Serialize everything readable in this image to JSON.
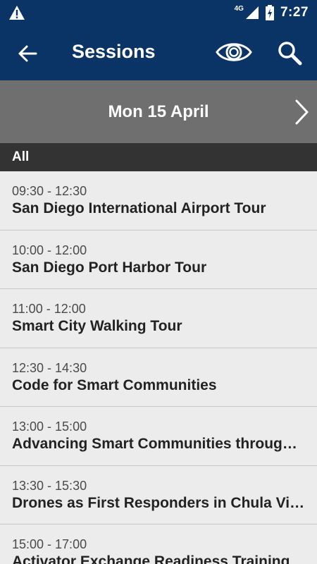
{
  "status_bar": {
    "network": "4G",
    "time": "7:27",
    "icons": [
      "warning-icon",
      "signal-icon",
      "battery-charging-icon"
    ]
  },
  "app_bar": {
    "title": "Sessions",
    "icons": [
      "back-arrow-icon",
      "eye-icon",
      "search-icon"
    ]
  },
  "date_bar": {
    "date": "Mon 15 April",
    "icon": "chevron-right-icon"
  },
  "filter": {
    "label": "All"
  },
  "sessions": [
    {
      "time": "09:30 - 12:30",
      "title": "San Diego International Airport Tour"
    },
    {
      "time": "10:00 - 12:00",
      "title": "San Diego Port Harbor Tour"
    },
    {
      "time": "11:00 - 12:00",
      "title": "Smart City Walking Tour"
    },
    {
      "time": "12:30 - 14:30",
      "title": "Code for Smart Communities"
    },
    {
      "time": "13:00 - 15:00",
      "title": "Advancing Smart Communities through Partnerships"
    },
    {
      "time": "13:30 - 15:30",
      "title": "Drones as First Responders in Chula Vista"
    },
    {
      "time": "15:00 - 17:00",
      "title": "Activator Exchange Readiness Training"
    }
  ],
  "colors": {
    "primary": "#0b3466",
    "date_bar": "#6f6f6f",
    "filter_bar": "#333333",
    "list_bg": "#ececec"
  }
}
